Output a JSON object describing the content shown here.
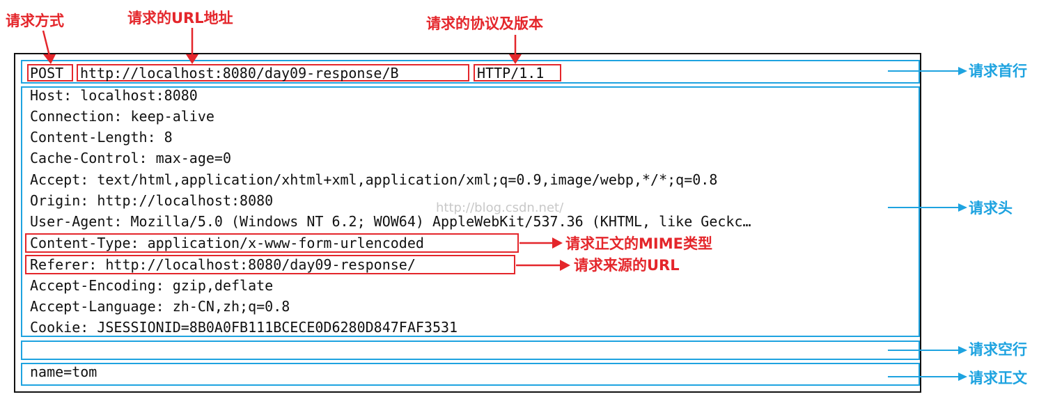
{
  "request_line": {
    "method": "POST",
    "url": "http://localhost:8080/day09-response/B",
    "protocol": "HTTP/1.1"
  },
  "headers": [
    "Host: localhost:8080",
    "Connection: keep-alive",
    "Content-Length: 8",
    "Cache-Control: max-age=0",
    "Accept: text/html,application/xhtml+xml,application/xml;q=0.9,image/webp,*/*;q=0.8",
    "Origin: http://localhost:8080",
    "User-Agent: Mozilla/5.0 (Windows NT 6.2; WOW64) AppleWebKit/537.36 (KHTML, like Geckc…",
    "Content-Type: application/x-www-form-urlencoded",
    "Referer: http://localhost:8080/day09-response/",
    "Accept-Encoding: gzip,deflate",
    "Accept-Language: zh-CN,zh;q=0.8",
    "Cookie: JSESSIONID=8B0A0FB111BCECE0D6280D847FAF3531"
  ],
  "body_text": "name=tom",
  "top_labels": {
    "method": "请求方式",
    "url": "请求的URL地址",
    "protocol": "请求的协议及版本"
  },
  "side_labels": {
    "request_line": "请求首行",
    "headers": "请求头",
    "blank_line": "请求空行",
    "body": "请求正文"
  },
  "inline_labels": {
    "content_type": "请求正文的MIME类型",
    "referer": "请求来源的URL"
  },
  "watermark": "http://blog.csdn.net/",
  "colors": {
    "red": "#e4262b",
    "blue": "#1ea3e0",
    "frame": "#111111"
  }
}
